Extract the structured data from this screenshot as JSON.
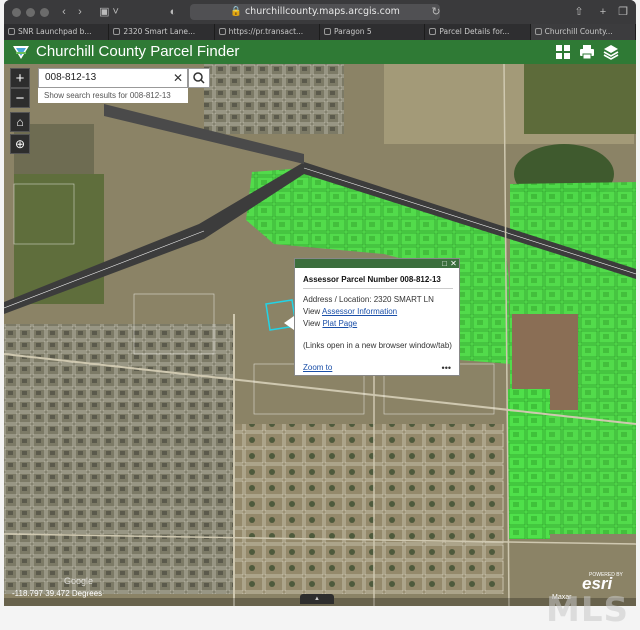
{
  "browser": {
    "url": "churchillcounty.maps.arcgis.com",
    "tabs": [
      {
        "label": "SNR Launchpad b...",
        "active": false
      },
      {
        "label": "2320 Smart Lane...",
        "active": false
      },
      {
        "label": "https://pr.transact...",
        "active": false
      },
      {
        "label": "Paragon 5",
        "active": false
      },
      {
        "label": "Parcel Details for...",
        "active": false
      },
      {
        "label": "Churchill County...",
        "active": true
      }
    ]
  },
  "app": {
    "title": "Churchill County Parcel Finder",
    "header_icons": [
      "grid-icon",
      "print-icon",
      "layers-icon"
    ]
  },
  "search": {
    "value": "008-812-13",
    "hint": "Show search results for 008-812-13"
  },
  "popup": {
    "title": "Assessor Parcel Number 008-812-13",
    "address_label": "Address / Location: 2320 SMART LN",
    "view_prefix": "View",
    "assessor_link": "Assessor Information",
    "plat_link": "Plat Page",
    "note": "(Links open in a new browser window/tab)",
    "zoom_to": "Zoom to",
    "more": "•••"
  },
  "map": {
    "coordinates": "-118.797 39.472 Degrees",
    "esri_label": "esri",
    "esri_sub": "POWERED BY",
    "attribution": "Maxar",
    "google": "Google",
    "parcel_color": "#4fe04a",
    "zoom_in": "+",
    "zoom_out": "−"
  },
  "watermark": "MLS"
}
